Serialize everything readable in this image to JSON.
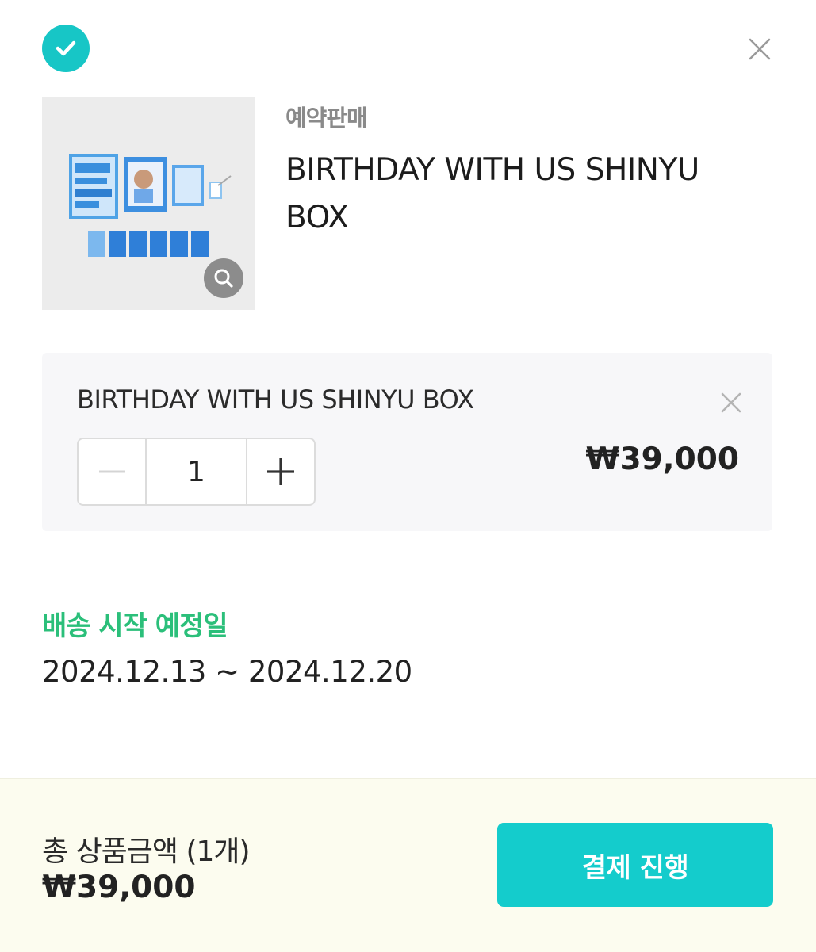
{
  "header": {
    "check_icon": "check-circle-icon",
    "close_icon": "close-icon"
  },
  "product": {
    "badge": "예약판매",
    "title": "BIRTHDAY WITH US SHINYU BOX",
    "image_icon": "product-thumbnail",
    "zoom_icon": "magnifier-icon"
  },
  "option": {
    "name": "BIRTHDAY WITH US SHINYU BOX",
    "quantity": "1",
    "price": "₩39,000",
    "remove_icon": "close-icon"
  },
  "shipping": {
    "label": "배송 시작 예정일",
    "dates": "2024.12.13 ~ 2024.12.20"
  },
  "footer": {
    "total_label": "총 상품금액 (1개)",
    "total_price": "₩39,000",
    "checkout_label": "결제 진행"
  },
  "colors": {
    "accent": "#14cccc",
    "shipping_label": "#2bbf7a",
    "footer_bg": "#fcfcef"
  }
}
